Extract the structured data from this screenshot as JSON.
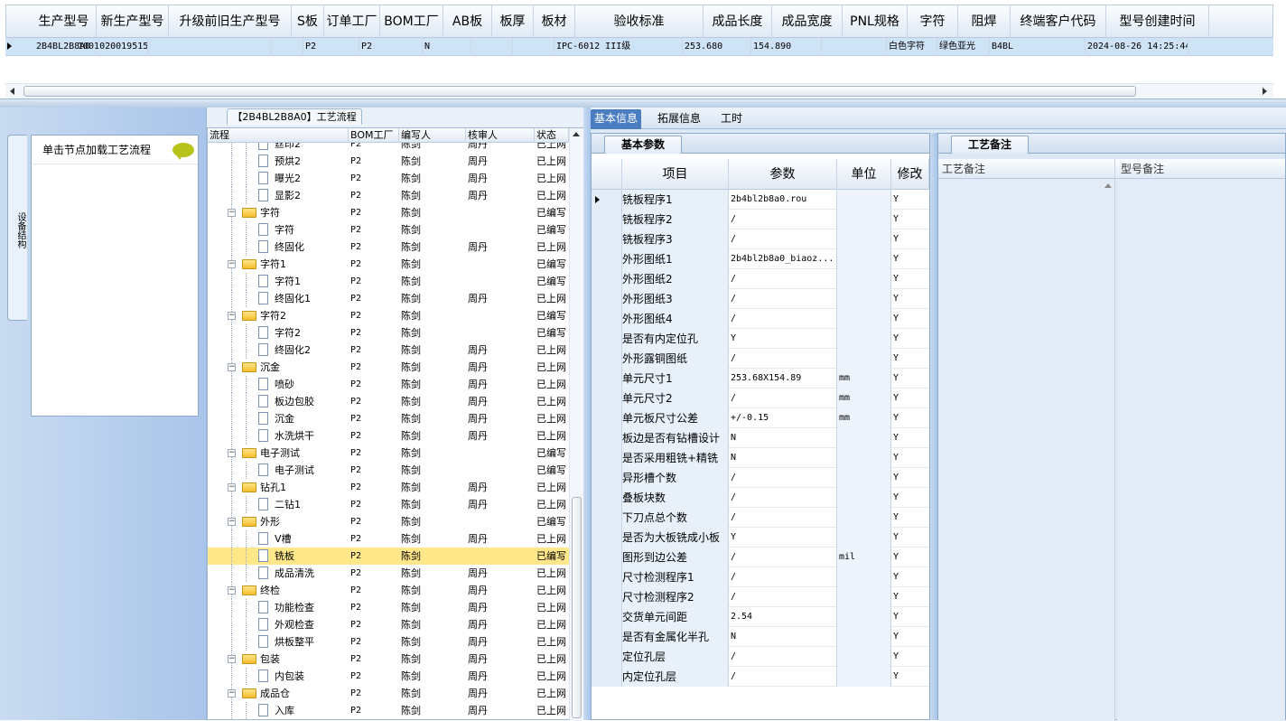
{
  "top_grid": {
    "headers": [
      "生产型号",
      "新生产型号",
      "升级前旧生产型号",
      "S板",
      "订单工厂",
      "BOM工厂",
      "AB板",
      "板厚",
      "板材",
      "验收标准",
      "成品长度",
      "成品宽度",
      "PNL规格",
      "字符",
      "阻焊",
      "终端客户代码",
      "型号创建时间"
    ],
    "row": [
      "2B4BL2B8A0",
      "10010200195154",
      "",
      "",
      "P2",
      "P2",
      "N",
      "",
      "",
      "IPC-6012 III级",
      "253.680",
      "154.890",
      "",
      "白色字符",
      "绿色亚光",
      "B4BL",
      "2024-08-26 14:25:44"
    ]
  },
  "left_panel": {
    "vertical_tab": "设备结构",
    "node_hint": "单击节点加载工艺流程"
  },
  "tree": {
    "title": "【2B4BL2B8A0】工艺流程",
    "headers": [
      "流程",
      "BOM工厂",
      "编写人",
      "核审人",
      "状态"
    ],
    "rows": [
      {
        "level": 2,
        "type": "doc",
        "name": "丝印2",
        "bom": "P2",
        "writer": "陈剑",
        "reviewer": "周丹",
        "status": "已上网"
      },
      {
        "level": 2,
        "type": "doc",
        "name": "预烘2",
        "bom": "P2",
        "writer": "陈剑",
        "reviewer": "周丹",
        "status": "已上网"
      },
      {
        "level": 2,
        "type": "doc",
        "name": "曝光2",
        "bom": "P2",
        "writer": "陈剑",
        "reviewer": "周丹",
        "status": "已上网"
      },
      {
        "level": 2,
        "type": "doc",
        "name": "显影2",
        "bom": "P2",
        "writer": "陈剑",
        "reviewer": "周丹",
        "status": "已上网"
      },
      {
        "level": 1,
        "type": "folder",
        "name": "字符",
        "bom": "P2",
        "writer": "陈剑",
        "reviewer": "",
        "status": "已编写"
      },
      {
        "level": 2,
        "type": "doc",
        "name": "字符",
        "bom": "P2",
        "writer": "陈剑",
        "reviewer": "",
        "status": "已编写"
      },
      {
        "level": 2,
        "type": "doc",
        "name": "终固化",
        "bom": "P2",
        "writer": "陈剑",
        "reviewer": "周丹",
        "status": "已上网"
      },
      {
        "level": 1,
        "type": "folder",
        "name": "字符1",
        "bom": "P2",
        "writer": "陈剑",
        "reviewer": "",
        "status": "已编写"
      },
      {
        "level": 2,
        "type": "doc",
        "name": "字符1",
        "bom": "P2",
        "writer": "陈剑",
        "reviewer": "",
        "status": "已编写"
      },
      {
        "level": 2,
        "type": "doc",
        "name": "终固化1",
        "bom": "P2",
        "writer": "陈剑",
        "reviewer": "周丹",
        "status": "已上网"
      },
      {
        "level": 1,
        "type": "folder",
        "name": "字符2",
        "bom": "P2",
        "writer": "陈剑",
        "reviewer": "",
        "status": "已编写"
      },
      {
        "level": 2,
        "type": "doc",
        "name": "字符2",
        "bom": "P2",
        "writer": "陈剑",
        "reviewer": "",
        "status": "已编写"
      },
      {
        "level": 2,
        "type": "doc",
        "name": "终固化2",
        "bom": "P2",
        "writer": "陈剑",
        "reviewer": "周丹",
        "status": "已上网"
      },
      {
        "level": 1,
        "type": "folder",
        "name": "沉金",
        "bom": "P2",
        "writer": "陈剑",
        "reviewer": "周丹",
        "status": "已上网"
      },
      {
        "level": 2,
        "type": "doc",
        "name": "喷砂",
        "bom": "P2",
        "writer": "陈剑",
        "reviewer": "周丹",
        "status": "已上网"
      },
      {
        "level": 2,
        "type": "doc",
        "name": "板边包胶",
        "bom": "P2",
        "writer": "陈剑",
        "reviewer": "周丹",
        "status": "已上网"
      },
      {
        "level": 2,
        "type": "doc",
        "name": "沉金",
        "bom": "P2",
        "writer": "陈剑",
        "reviewer": "周丹",
        "status": "已上网"
      },
      {
        "level": 2,
        "type": "doc",
        "name": "水洗烘干",
        "bom": "P2",
        "writer": "陈剑",
        "reviewer": "周丹",
        "status": "已上网"
      },
      {
        "level": 1,
        "type": "folder",
        "name": "电子测试",
        "bom": "P2",
        "writer": "陈剑",
        "reviewer": "",
        "status": "已编写"
      },
      {
        "level": 2,
        "type": "doc",
        "name": "电子测试",
        "bom": "P2",
        "writer": "陈剑",
        "reviewer": "",
        "status": "已编写"
      },
      {
        "level": 1,
        "type": "folder",
        "name": "钻孔1",
        "bom": "P2",
        "writer": "陈剑",
        "reviewer": "周丹",
        "status": "已上网"
      },
      {
        "level": 2,
        "type": "doc",
        "name": "二钻1",
        "bom": "P2",
        "writer": "陈剑",
        "reviewer": "周丹",
        "status": "已上网"
      },
      {
        "level": 1,
        "type": "folder",
        "name": "外形",
        "bom": "P2",
        "writer": "陈剑",
        "reviewer": "",
        "status": "已编写"
      },
      {
        "level": 2,
        "type": "doc",
        "name": "V槽",
        "bom": "P2",
        "writer": "陈剑",
        "reviewer": "周丹",
        "status": "已上网"
      },
      {
        "level": 2,
        "type": "doc",
        "name": "铣板",
        "bom": "P2",
        "writer": "陈剑",
        "reviewer": "",
        "status": "已编写",
        "selected": true
      },
      {
        "level": 2,
        "type": "doc",
        "name": "成品清洗",
        "bom": "P2",
        "writer": "陈剑",
        "reviewer": "周丹",
        "status": "已上网"
      },
      {
        "level": 1,
        "type": "folder",
        "name": "终检",
        "bom": "P2",
        "writer": "陈剑",
        "reviewer": "周丹",
        "status": "已上网"
      },
      {
        "level": 2,
        "type": "doc",
        "name": "功能检查",
        "bom": "P2",
        "writer": "陈剑",
        "reviewer": "周丹",
        "status": "已上网"
      },
      {
        "level": 2,
        "type": "doc",
        "name": "外观检查",
        "bom": "P2",
        "writer": "陈剑",
        "reviewer": "周丹",
        "status": "已上网"
      },
      {
        "level": 2,
        "type": "doc",
        "name": "烘板整平",
        "bom": "P2",
        "writer": "陈剑",
        "reviewer": "周丹",
        "status": "已上网"
      },
      {
        "level": 1,
        "type": "folder",
        "name": "包装",
        "bom": "P2",
        "writer": "陈剑",
        "reviewer": "周丹",
        "status": "已上网"
      },
      {
        "level": 2,
        "type": "doc",
        "name": "内包装",
        "bom": "P2",
        "writer": "陈剑",
        "reviewer": "周丹",
        "status": "已上网"
      },
      {
        "level": 1,
        "type": "folder",
        "name": "成品仓",
        "bom": "P2",
        "writer": "陈剑",
        "reviewer": "周丹",
        "status": "已上网"
      },
      {
        "level": 2,
        "type": "doc",
        "name": "入库",
        "bom": "P2",
        "writer": "陈剑",
        "reviewer": "周丹",
        "status": "已上网"
      }
    ]
  },
  "right_tabs": [
    "基本信息",
    "拓展信息",
    "工时"
  ],
  "basic_params": {
    "tab": "基本参数",
    "headers": [
      "项目",
      "参数",
      "单位",
      "修改"
    ],
    "rows": [
      {
        "name": "铣板程序1",
        "value": "2b4bl2b8a0.rou",
        "unit": "",
        "mod": "Y"
      },
      {
        "name": "铣板程序2",
        "value": "/",
        "unit": "",
        "mod": "Y"
      },
      {
        "name": "铣板程序3",
        "value": "/",
        "unit": "",
        "mod": "Y"
      },
      {
        "name": "外形图纸1",
        "value": "2b4bl2b8a0_biaoz...",
        "unit": "",
        "mod": "Y"
      },
      {
        "name": "外形图纸2",
        "value": "/",
        "unit": "",
        "mod": "Y"
      },
      {
        "name": "外形图纸3",
        "value": "/",
        "unit": "",
        "mod": "Y"
      },
      {
        "name": "外形图纸4",
        "value": "/",
        "unit": "",
        "mod": "Y"
      },
      {
        "name": "是否有内定位孔",
        "value": "Y",
        "unit": "",
        "mod": "Y"
      },
      {
        "name": "外形露铜图纸",
        "value": "/",
        "unit": "",
        "mod": "Y"
      },
      {
        "name": "单元尺寸1",
        "value": "253.68X154.89",
        "unit": "mm",
        "mod": "Y"
      },
      {
        "name": "单元尺寸2",
        "value": "/",
        "unit": "mm",
        "mod": "Y"
      },
      {
        "name": "单元板尺寸公差",
        "value": "+/-0.15",
        "unit": "mm",
        "mod": "Y"
      },
      {
        "name": "板边是否有钻槽设计",
        "value": "N",
        "unit": "",
        "mod": "Y"
      },
      {
        "name": "是否采用粗铣+精铣",
        "value": "N",
        "unit": "",
        "mod": "Y"
      },
      {
        "name": "异形槽个数",
        "value": "/",
        "unit": "",
        "mod": "Y"
      },
      {
        "name": "叠板块数",
        "value": "/",
        "unit": "",
        "mod": "Y"
      },
      {
        "name": "下刀点总个数",
        "value": "/",
        "unit": "",
        "mod": "Y"
      },
      {
        "name": "是否为大板铣成小板",
        "value": "Y",
        "unit": "",
        "mod": "Y"
      },
      {
        "name": "图形到边公差",
        "value": "/",
        "unit": "mil",
        "mod": "Y"
      },
      {
        "name": "尺寸检测程序1",
        "value": "/",
        "unit": "",
        "mod": "Y"
      },
      {
        "name": "尺寸检测程序2",
        "value": "/",
        "unit": "",
        "mod": "Y"
      },
      {
        "name": "交货单元间距",
        "value": "2.54",
        "unit": "",
        "mod": "Y"
      },
      {
        "name": "是否有金属化半孔",
        "value": "N",
        "unit": "",
        "mod": "Y"
      },
      {
        "name": "定位孔层",
        "value": "/",
        "unit": "",
        "mod": "Y"
      },
      {
        "name": "内定位孔层",
        "value": "/",
        "unit": "",
        "mod": "Y"
      }
    ]
  },
  "notes": {
    "tab": "工艺备注",
    "col1": "工艺备注",
    "col2": "型号备注"
  }
}
